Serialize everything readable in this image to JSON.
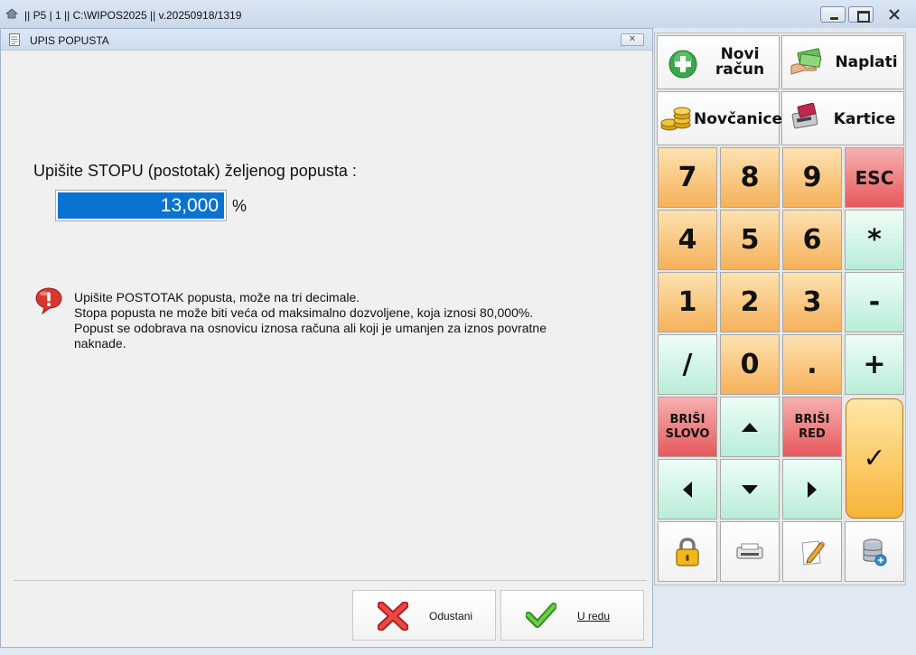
{
  "window": {
    "title": "|| P5 | 1 || C:\\WIPOS2025 || v.20250918/1319"
  },
  "dialog": {
    "title": "UPIS POPUSTA",
    "prompt": "Upišite STOPU (postotak) željenog popusta :",
    "value": "13,000",
    "unit": "%",
    "info_lines": [
      "Upišite POSTOTAK popusta, može na tri decimale.",
      "Stopa popusta ne može biti veća od maksimalno dozvoljene, koja iznosi 80,000%.",
      "Popust se odobrava na osnovicu iznosa računa ali koji je umanjen za iznos povratne",
      "naknade."
    ],
    "buttons": {
      "cancel": "Odustani",
      "ok": "U redu"
    }
  },
  "keypad": {
    "top": {
      "new_bill": [
        "Novi",
        "račun"
      ],
      "pay": "Naplati",
      "cash": "Novčanice",
      "cards": "Kartice"
    },
    "digits": [
      "7",
      "8",
      "9",
      "4",
      "5",
      "6",
      "1",
      "2",
      "3",
      "0"
    ],
    "esc": "ESC",
    "multiply": "*",
    "minus": "-",
    "plus": "+",
    "slash": "/",
    "dot": ".",
    "delete_char": [
      "BRIŠI",
      "SLOVO"
    ],
    "delete_row": [
      "BRIŠI",
      "RED"
    ],
    "enter": "✓"
  },
  "colors": {
    "selection": "#0a72d2",
    "key_orange": "#f6b15a",
    "key_mint": "#b9edd8",
    "key_red": "#e7585c"
  }
}
